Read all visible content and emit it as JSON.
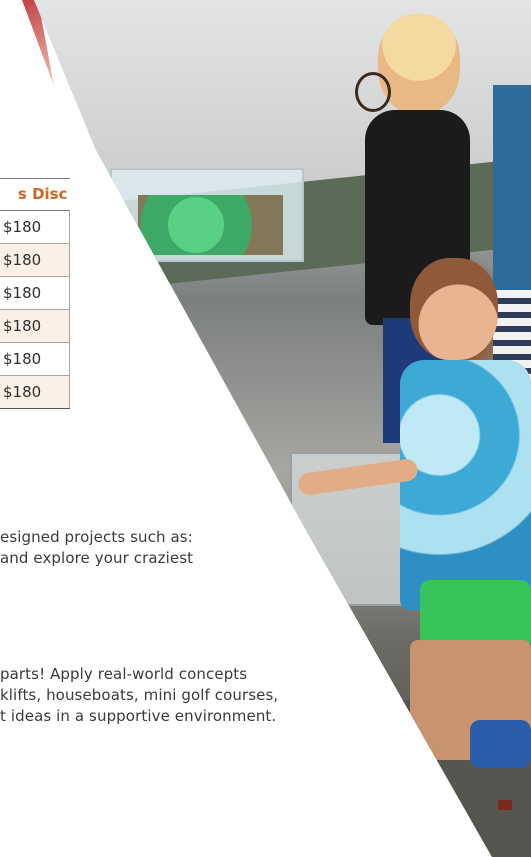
{
  "table": {
    "header": "s Disc",
    "rows": [
      {
        "value": "$180"
      },
      {
        "value": "$180"
      },
      {
        "value": "$180"
      },
      {
        "value": "$180"
      },
      {
        "value": "$180"
      },
      {
        "value": "$180"
      }
    ]
  },
  "paragraph_1": {
    "lines": [
      "esigned projects such as:",
      "and explore your craziest"
    ]
  },
  "paragraph_2": {
    "lines": [
      " parts! Apply real-world concepts",
      "klifts, houseboats, mini golf courses,",
      "t ideas in a supportive environment."
    ]
  },
  "colors": {
    "header_text": "#d06620",
    "alt_row": "#fcf0e6",
    "body_text": "#3a3a3a"
  },
  "photo": {
    "description_icon": "kids-building-photo"
  }
}
